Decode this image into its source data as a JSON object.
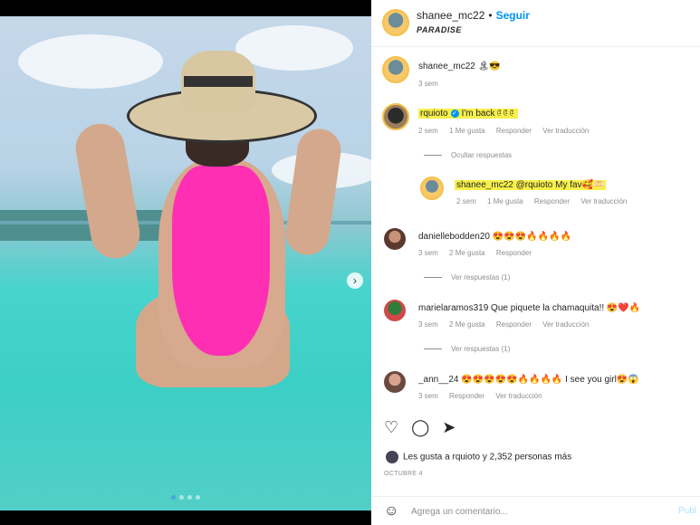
{
  "post": {
    "username": "shanee_mc22",
    "separator": "•",
    "follow_label": "Seguir",
    "location": "PARADISE",
    "caption": {
      "username": "shanee_mc22",
      "text": "🏝😎",
      "time": "3 sem"
    },
    "carousel_dots": 4,
    "carousel_active": 0
  },
  "comments": [
    {
      "username": "rquioto",
      "verified": true,
      "text": "I'm back 🤅🤅🤅",
      "meta": {
        "time": "2 sem",
        "likes": "1 Me gusta",
        "reply": "Responder",
        "translate": "Ver traducción"
      },
      "thread_label": "Ocultar respuestas",
      "reply": {
        "username": "shanee_mc22",
        "text": "@rquioto My fav🥰🫶🏻",
        "meta": {
          "time": "2 sem",
          "likes": "1 Me gusta",
          "reply": "Responder",
          "translate": "Ver traducción"
        }
      }
    },
    {
      "username": "daniellebodden20",
      "text": "😍😍😍🔥🔥🔥🔥",
      "meta": {
        "time": "3 sem",
        "likes": "2 Me gusta",
        "reply": "Responder"
      },
      "thread_label": "Ver respuestas (1)"
    },
    {
      "username": "marielaramos319",
      "text": "Que piquete la chamaquita!! 😍❤️🔥",
      "meta": {
        "time": "3 sem",
        "likes": "2 Me gusta",
        "reply": "Responder",
        "translate": "Ver traducción"
      },
      "thread_label": "Ver respuestas (1)"
    },
    {
      "username": "_ann__24",
      "text": "😍😍😍😍😍🔥🔥🔥🔥 I see you girl😍😱",
      "meta": {
        "time": "3 sem",
        "reply": "Responder",
        "translate": "Ver traducción"
      }
    }
  ],
  "likes_text": "Les gusta a rquioto y 2,352 personas más",
  "date": "OCTUBRE 4",
  "add_comment": {
    "placeholder": "Agrega un comentario...",
    "publish": "Publ"
  },
  "icons": {
    "like": "heart-icon",
    "comment": "comment-icon",
    "share": "send-icon",
    "emoji": "smiley-icon"
  },
  "colors": {
    "follow": "#0095f6",
    "highlight": "#f7f04a",
    "swimsuit": "#ff2fb3"
  }
}
